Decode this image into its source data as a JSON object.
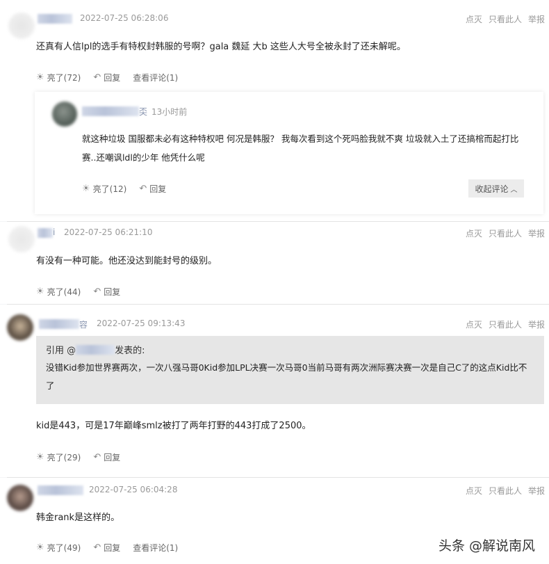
{
  "common": {
    "action_hide": "点灭",
    "action_only": "只看此人",
    "action_report": "举报",
    "reply_label": "回复",
    "like_prefix": "亮了"
  },
  "comments": [
    {
      "time": "2022-07-25 06:28:06",
      "text": "还真有人信lpl的选手有特权封韩服的号啊？gala  魏延  大b 这些人大号全被永封了还未解呢。",
      "likes": "(72)",
      "view_replies": "查看评论(1)"
    },
    {
      "time": "2022-07-25 06:21:10",
      "text": "有没有一种可能。他还没达到能封号的级别。",
      "likes": "(44)"
    },
    {
      "time": "2022-07-25 09:13:43",
      "text": "kid是443，可是17年巅峰smlz被打了两年打野的443打成了2500。",
      "likes": "(29)"
    },
    {
      "time": "2022-07-25 06:04:28",
      "text": "韩金rank是这样的。",
      "likes": "(49)",
      "view_replies": "查看评论(1)"
    }
  ],
  "reply": {
    "name_suffix": "奀",
    "time": "13小时前",
    "text_line1": "就这种垃圾 国服都未必有这种特权吧 何况是韩服？ 我每次看到这个死吗脸我就不爽  垃圾就入土了还搞棺而起打比",
    "text_line2": "赛..还嘲讽ldl的少年 他凭什么呢",
    "likes": "(12)",
    "collapse": "收起评论"
  },
  "comment2_name_suffix": "i",
  "comment3_name_suffix": "容",
  "quote": {
    "prefix": "引用 @",
    "suffix": "发表的:",
    "text_line1": "没错Kid参加世界赛两次，一次八强马哥0Kid参加LPL决赛一次马哥0当前马哥有两次洲际赛决赛一次是自己C了的这点Kid比不",
    "text_line2": "了"
  },
  "watermark": "头条 @解说南风"
}
